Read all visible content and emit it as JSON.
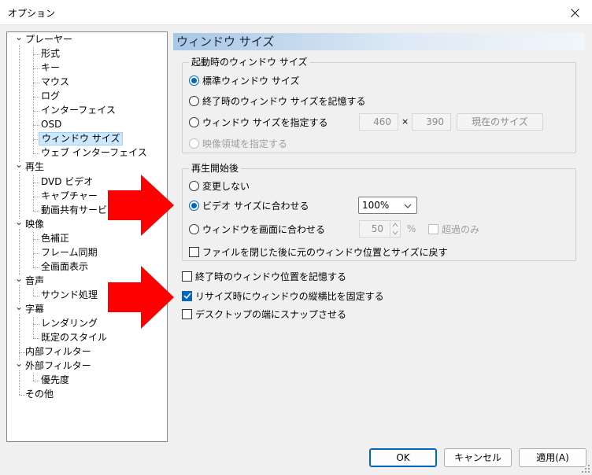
{
  "window": {
    "title": "オプション"
  },
  "tree": {
    "items": [
      {
        "label": "プレーヤー",
        "level": 0,
        "expanded": true
      },
      {
        "label": "形式",
        "level": 1
      },
      {
        "label": "キー",
        "level": 1
      },
      {
        "label": "マウス",
        "level": 1
      },
      {
        "label": "ログ",
        "level": 1
      },
      {
        "label": "インターフェイス",
        "level": 1
      },
      {
        "label": "OSD",
        "level": 1
      },
      {
        "label": "ウィンドウ サイズ",
        "level": 1,
        "selected": true
      },
      {
        "label": "ウェブ インターフェイス",
        "level": 1
      },
      {
        "label": "再生",
        "level": 0,
        "expanded": true
      },
      {
        "label": "DVD ビデオ",
        "level": 1
      },
      {
        "label": "キャプチャー",
        "level": 1
      },
      {
        "label": "動画共有サービス",
        "level": 1
      },
      {
        "label": "映像",
        "level": 0,
        "expanded": true
      },
      {
        "label": "色補正",
        "level": 1
      },
      {
        "label": "フレーム同期",
        "level": 1
      },
      {
        "label": "全画面表示",
        "level": 1
      },
      {
        "label": "音声",
        "level": 0,
        "expanded": true
      },
      {
        "label": "サウンド処理",
        "level": 1
      },
      {
        "label": "字幕",
        "level": 0,
        "expanded": true
      },
      {
        "label": "レンダリング",
        "level": 1
      },
      {
        "label": "既定のスタイル",
        "level": 1
      },
      {
        "label": "内部フィルター",
        "level": 0
      },
      {
        "label": "外部フィルター",
        "level": 0,
        "expanded": true
      },
      {
        "label": "優先度",
        "level": 1
      },
      {
        "label": "その他",
        "level": 0
      }
    ]
  },
  "panel": {
    "title": "ウィンドウ サイズ",
    "startup": {
      "legend": "起動時のウィンドウ サイズ",
      "opt_standard": "標準ウィンドウ サイズ",
      "opt_remember": "終了時のウィンドウ サイズを記憶する",
      "opt_specify": "ウィンドウ サイズを指定する",
      "opt_video_area": "映像領域を指定する",
      "width": "460",
      "times": "×",
      "height": "390",
      "current_size_button": "現在のサイズ"
    },
    "playback": {
      "legend": "再生開始後",
      "opt_no_change": "変更しない",
      "opt_fit_video": "ビデオ サイズに合わせる",
      "zoom_value": "100%",
      "opt_fit_screen": "ウィンドウを画面に合わせる",
      "screen_percent": "50",
      "percent_unit": "%",
      "over_only": "超過のみ",
      "restore_on_close": "ファイルを閉じた後に元のウィンドウ位置とサイズに戻す"
    },
    "remember_position": "終了時のウィンドウ位置を記憶する",
    "lock_aspect": "リサイズ時にウィンドウの縦横比を固定する",
    "snap_to_edge": "デスクトップの端にスナップさせる"
  },
  "footer": {
    "ok": "OK",
    "cancel": "キャンセル",
    "apply": "適用(A)"
  },
  "colors": {
    "accent": "#0067c0",
    "selection": "#cce8ff",
    "arrow": "#ff0000"
  }
}
